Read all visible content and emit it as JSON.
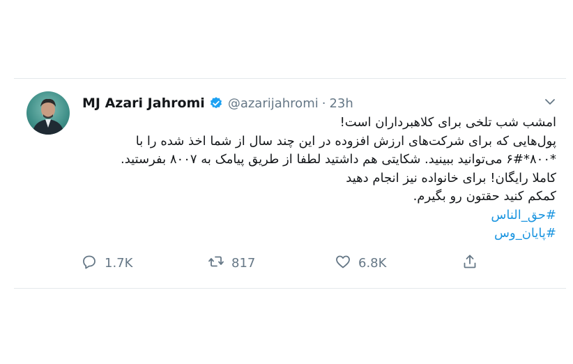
{
  "tweet": {
    "display_name": "MJ Azari Jahromi",
    "handle": "@azarijahromi",
    "separator": "·",
    "time": "23h",
    "lines": [
      "امشب شب تلخی برای کلاهبرداران است!",
      "پول‌هایی که برای شرکت‌های ارزش افزوده در این چند سال از شما اخذ شده را با",
      "*۸۰۰*۶# می‌توانید ببینید. شکایتی هم داشتید لطفا از طریق پیامک به ۸۰۰۷ بفرستید.",
      "کاملا رایگان! برای خانواده نیز انجام دهید",
      "کمکم کنید حقتون رو بگیرم."
    ],
    "hashtags": [
      "#حق_الناس",
      "#پایان_وس"
    ],
    "replies": "1.7K",
    "retweets": "817",
    "likes": "6.8K"
  },
  "icons": {
    "verified": "verified-badge-icon",
    "more": "chevron-down-icon",
    "reply": "reply-icon",
    "retweet": "retweet-icon",
    "like": "heart-icon",
    "share": "share-icon"
  },
  "colors": {
    "text": "#14171a",
    "muted": "#657786",
    "link": "#1b95e0",
    "verified": "#1da1f2"
  }
}
